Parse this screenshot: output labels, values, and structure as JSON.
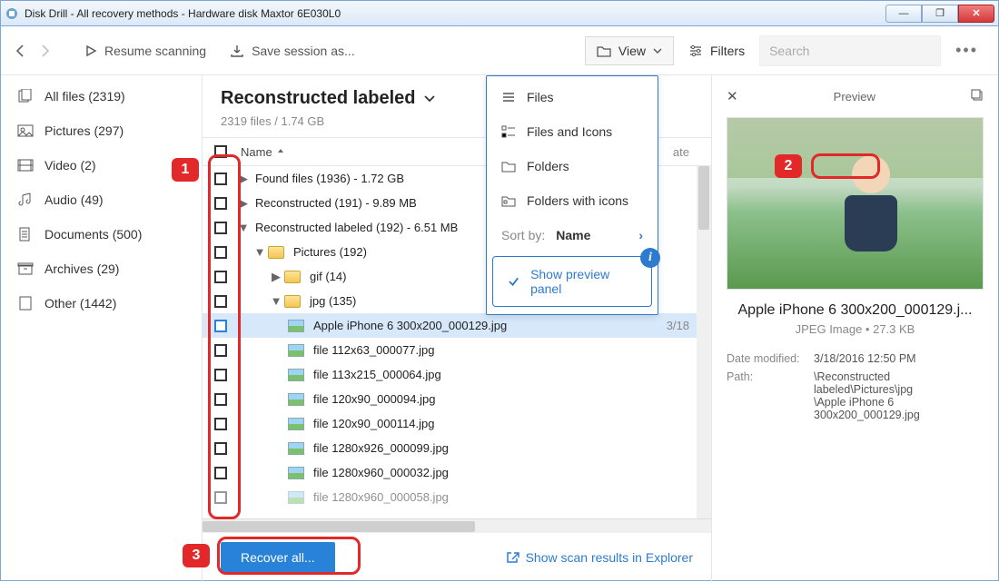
{
  "window": {
    "title": "Disk Drill - All recovery methods - Hardware disk Maxtor 6E030L0"
  },
  "toolbar": {
    "resume": "Resume scanning",
    "save_session": "Save session as...",
    "view": "View",
    "filters": "Filters",
    "search_placeholder": "Search"
  },
  "sidebar": {
    "items": [
      {
        "label": "All files (2319)"
      },
      {
        "label": "Pictures (297)"
      },
      {
        "label": "Video (2)"
      },
      {
        "label": "Audio (49)"
      },
      {
        "label": "Documents (500)"
      },
      {
        "label": "Archives (29)"
      },
      {
        "label": "Other (1442)"
      }
    ]
  },
  "main": {
    "heading": "Reconstructed labeled",
    "sub": "2319 files / 1.74 GB",
    "col_name": "Name",
    "col_date_hint": "ate",
    "rows": [
      {
        "label": "Found files (1936) - 1.72 GB"
      },
      {
        "label": "Reconstructed (191) - 9.89 MB"
      },
      {
        "label": "Reconstructed labeled (192) - 6.51 MB"
      },
      {
        "label": "Pictures (192)"
      },
      {
        "label": "gif (14)"
      },
      {
        "label": "jpg (135)"
      },
      {
        "label": "Apple iPhone 6 300x200_000129.jpg",
        "date": "3/18"
      },
      {
        "label": "file 112x63_000077.jpg"
      },
      {
        "label": "file 113x215_000064.jpg"
      },
      {
        "label": "file 120x90_000094.jpg"
      },
      {
        "label": "file 120x90_000114.jpg"
      },
      {
        "label": "file 1280x926_000099.jpg"
      },
      {
        "label": "file 1280x960_000032.jpg"
      },
      {
        "label": "file 1280x960_000058.jpg"
      }
    ]
  },
  "view_menu": {
    "files": "Files",
    "files_icons": "Files and Icons",
    "folders": "Folders",
    "folders_icons": "Folders with icons",
    "sort_by": "Sort by:",
    "sort_val": "Name",
    "show_preview": "Show preview panel"
  },
  "preview": {
    "title": "Preview",
    "filename": "Apple iPhone 6 300x200_000129.j...",
    "meta": "JPEG Image • 27.3 KB",
    "date_k": "Date modified:",
    "date_v": "3/18/2016 12:50 PM",
    "path_k": "Path:",
    "path_v1": "\\Reconstructed labeled\\Pictures\\jpg",
    "path_v2": "\\Apple iPhone 6 300x200_000129.jpg"
  },
  "footer": {
    "recover": "Recover all...",
    "explorer_link": "Show scan results in Explorer"
  },
  "annotations": {
    "b1": "1",
    "b2": "2",
    "b3": "3"
  }
}
